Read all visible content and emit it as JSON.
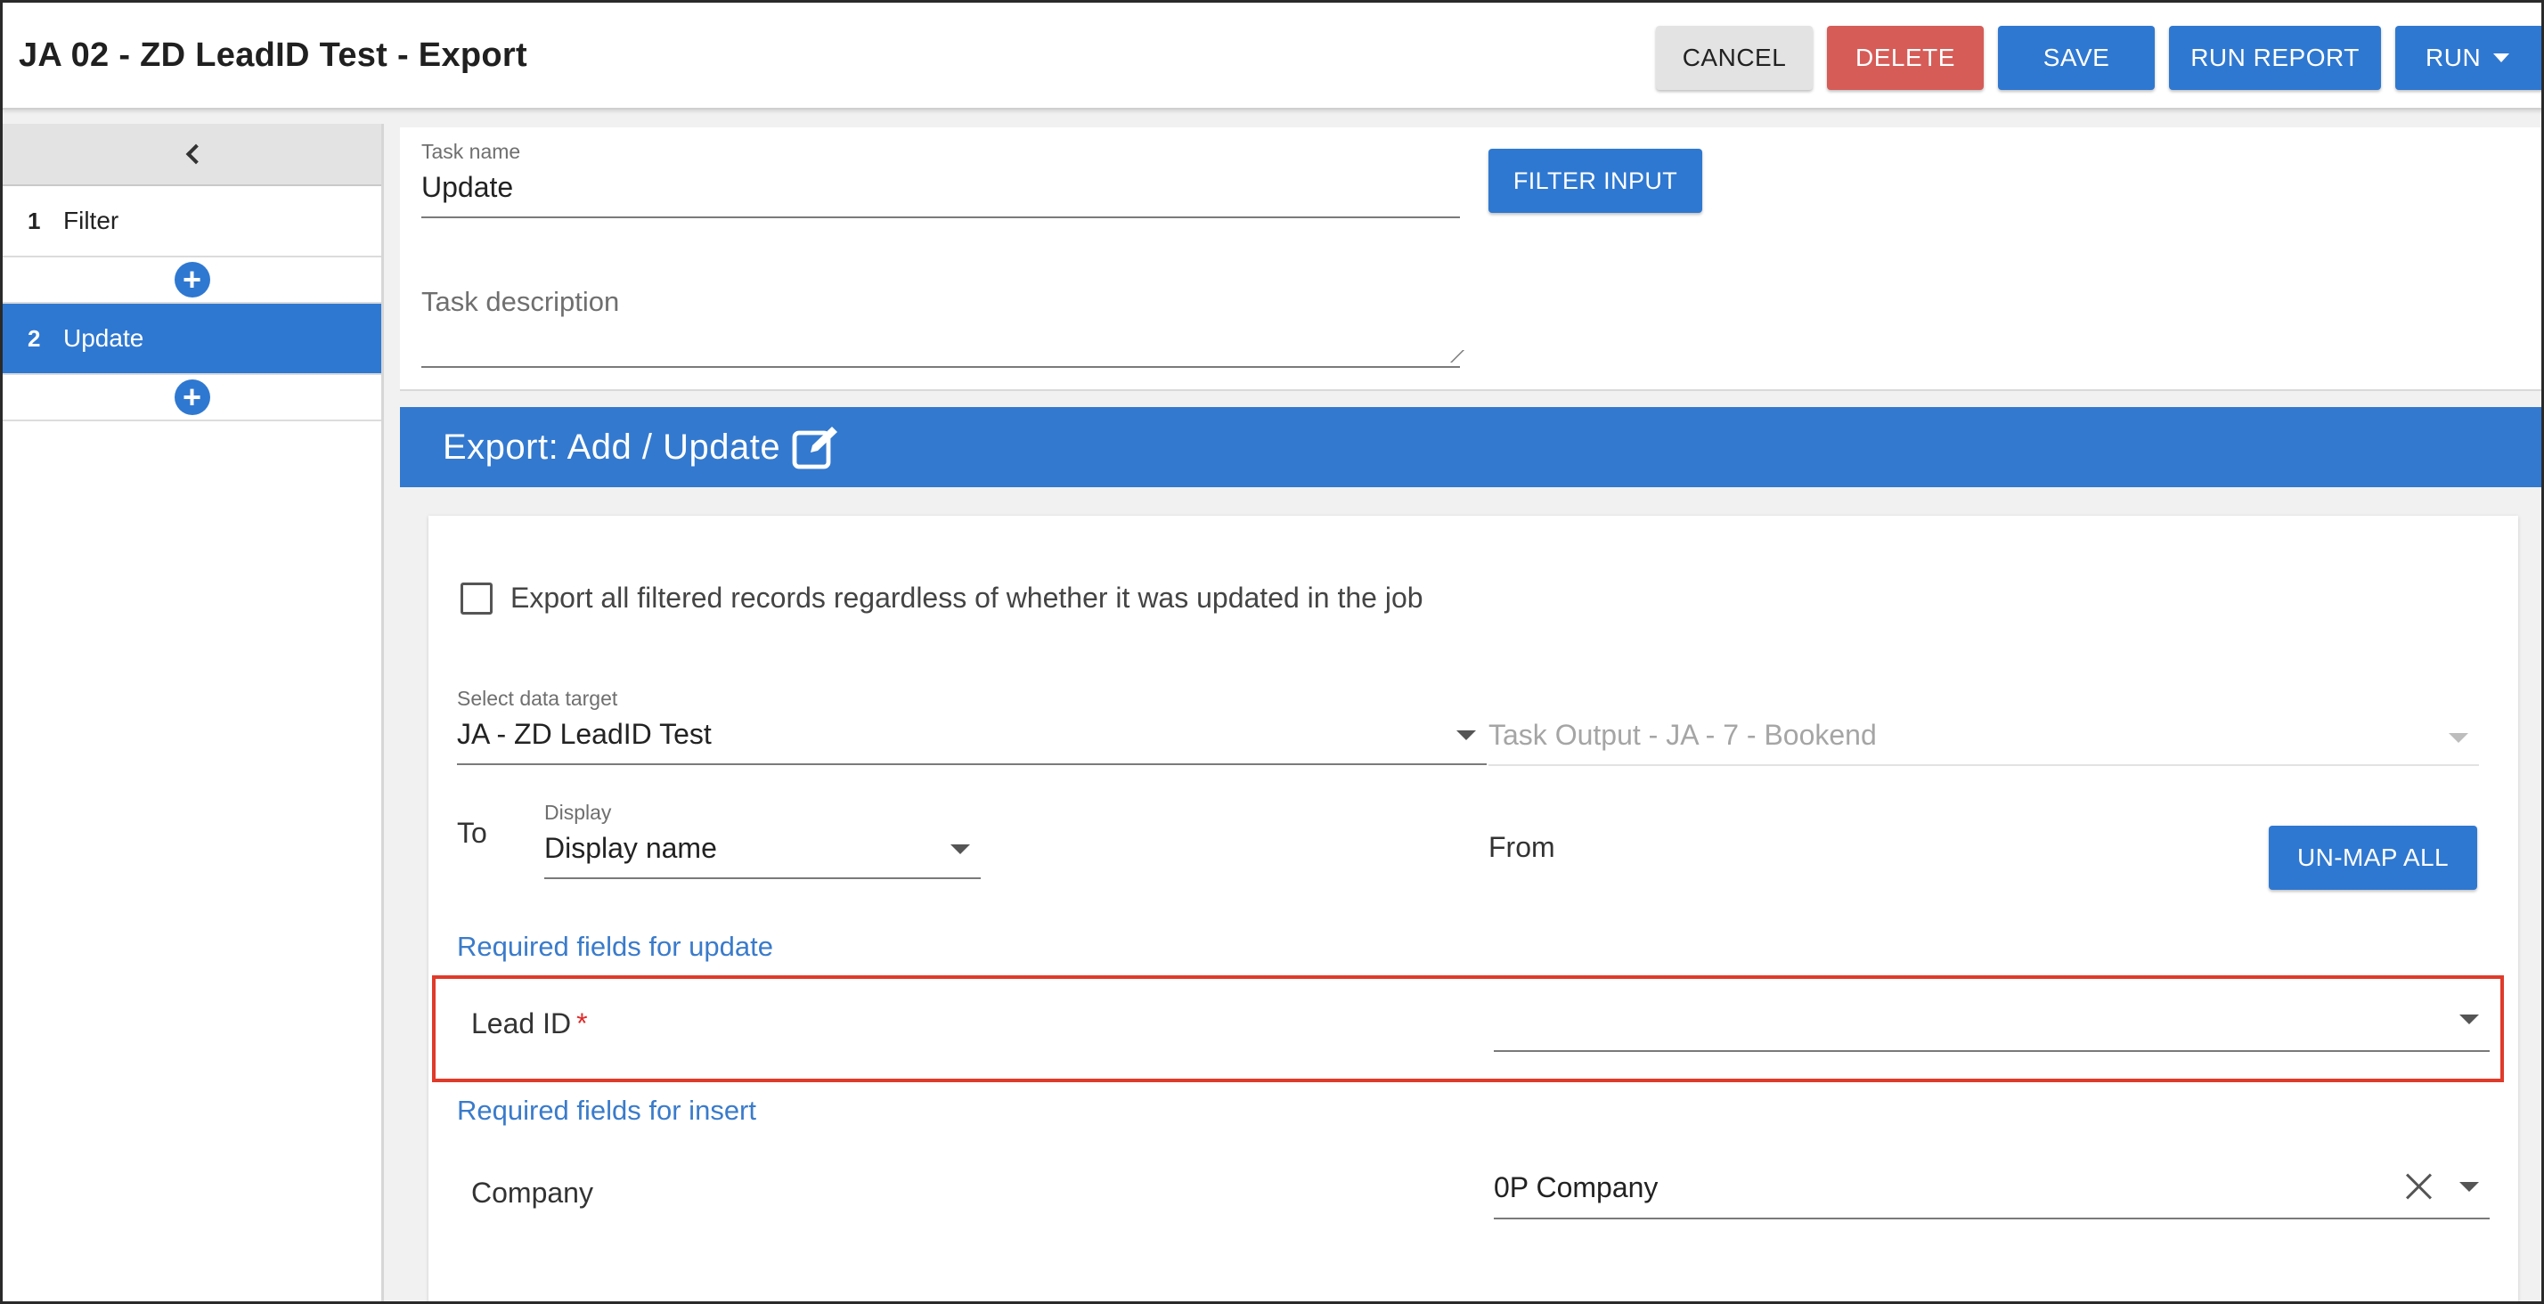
{
  "header": {
    "title": "JA 02 - ZD LeadID Test - Export",
    "buttons": {
      "cancel": "CANCEL",
      "delete": "DELETE",
      "save": "SAVE",
      "run_report": "RUN REPORT",
      "run": "RUN"
    }
  },
  "sidebar": {
    "steps": [
      {
        "num": "1",
        "label": "Filter",
        "active": false
      },
      {
        "num": "2",
        "label": "Update",
        "active": true
      }
    ]
  },
  "task": {
    "name_label": "Task name",
    "name_value": "Update",
    "description_placeholder": "Task description",
    "filter_button": "FILTER INPUT"
  },
  "export": {
    "section_title": "Export: Add / Update",
    "export_all_checkbox": {
      "label": "Export all filtered records regardless of whether it was updated in the job",
      "checked": false
    },
    "data_target": {
      "label": "Select data target",
      "value": "JA - ZD LeadID Test"
    },
    "task_output": "Task Output - JA - 7 - Bookend",
    "to_label": "To",
    "display": {
      "label": "Display",
      "value": "Display name"
    },
    "from_label": "From",
    "unmap_button": "UN-MAP ALL",
    "required_update_heading": "Required fields for update",
    "required_insert_heading": "Required fields for insert",
    "mappings": [
      {
        "field": "Lead ID",
        "required": "*",
        "value": ""
      },
      {
        "field": "Company",
        "value": "0P Company"
      }
    ]
  },
  "colors": {
    "primary": "#2f78d1",
    "danger": "#d65c58",
    "highlight": "#e03a2a",
    "link": "#3a7bcb"
  }
}
